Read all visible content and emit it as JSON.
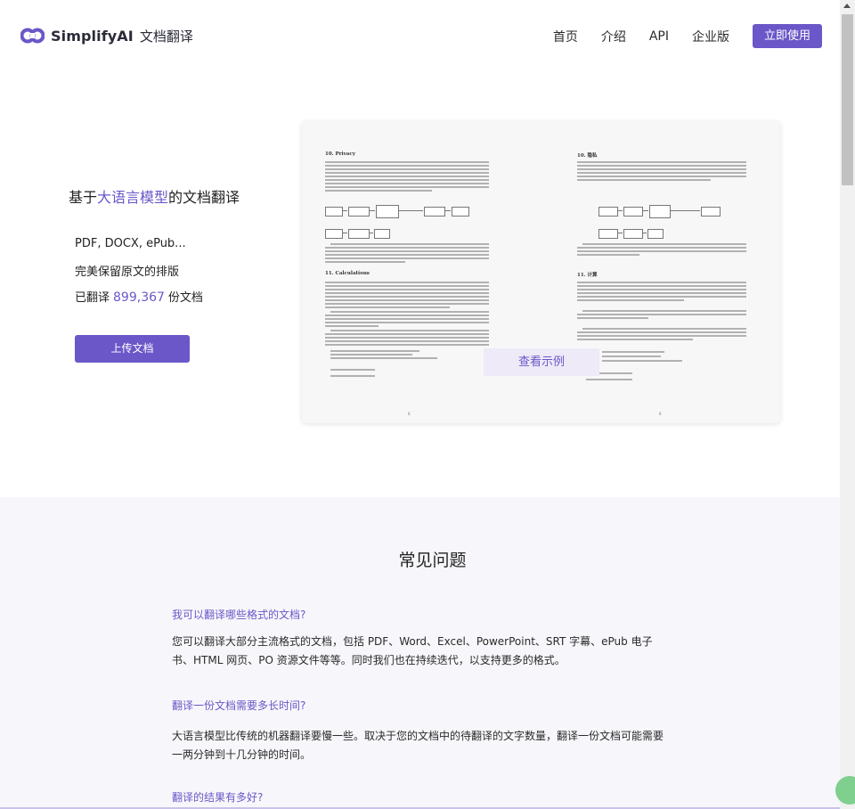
{
  "header": {
    "brand": "SimplifyAI",
    "product": "文档翻译",
    "nav": [
      "首页",
      "介绍",
      "API",
      "企业版"
    ],
    "cta": "立即使用"
  },
  "hero": {
    "title_prefix": "基于",
    "title_highlight": "大语言模型",
    "title_suffix": "的文档翻译",
    "formats": "PDF, DOCX, ePub...",
    "layout": "完美保留原文的排版",
    "translated_prefix": "已翻译",
    "translated_count": "899,367",
    "translated_suffix": "份文档",
    "upload_button": "上传文档"
  },
  "preview": {
    "left_heading_1": "10.  Privacy",
    "left_heading_2": "11.  Calculations",
    "right_heading_1": "10. 隐私",
    "right_heading_2": "11. 计算",
    "page_left": "6",
    "page_right": "6",
    "example_button": "查看示例"
  },
  "faq": {
    "title": "常见问题",
    "items": [
      {
        "q": "我可以翻译哪些格式的文档?",
        "a": "您可以翻译大部分主流格式的文档，包括 PDF、Word、Excel、PowerPoint、SRT 字幕、ePub 电子书、HTML 网页、PO 资源文件等等。同时我们也在持续迭代，以支持更多的格式。"
      },
      {
        "q": "翻译一份文档需要多长时间?",
        "a": "大语言模型比传统的机器翻译要慢一些。取决于您的文档中的待翻译的文字数量，翻译一份文档可能需要一两分钟到十几分钟的时间。"
      },
      {
        "q": "翻译的结果有多好?"
      }
    ]
  },
  "colors": {
    "accent": "#6b57c8",
    "faq_background": "#f7f7fb",
    "example_button_bg": "#eeeaf8"
  },
  "icons": [
    "logo-icon",
    "chat-icon"
  ]
}
